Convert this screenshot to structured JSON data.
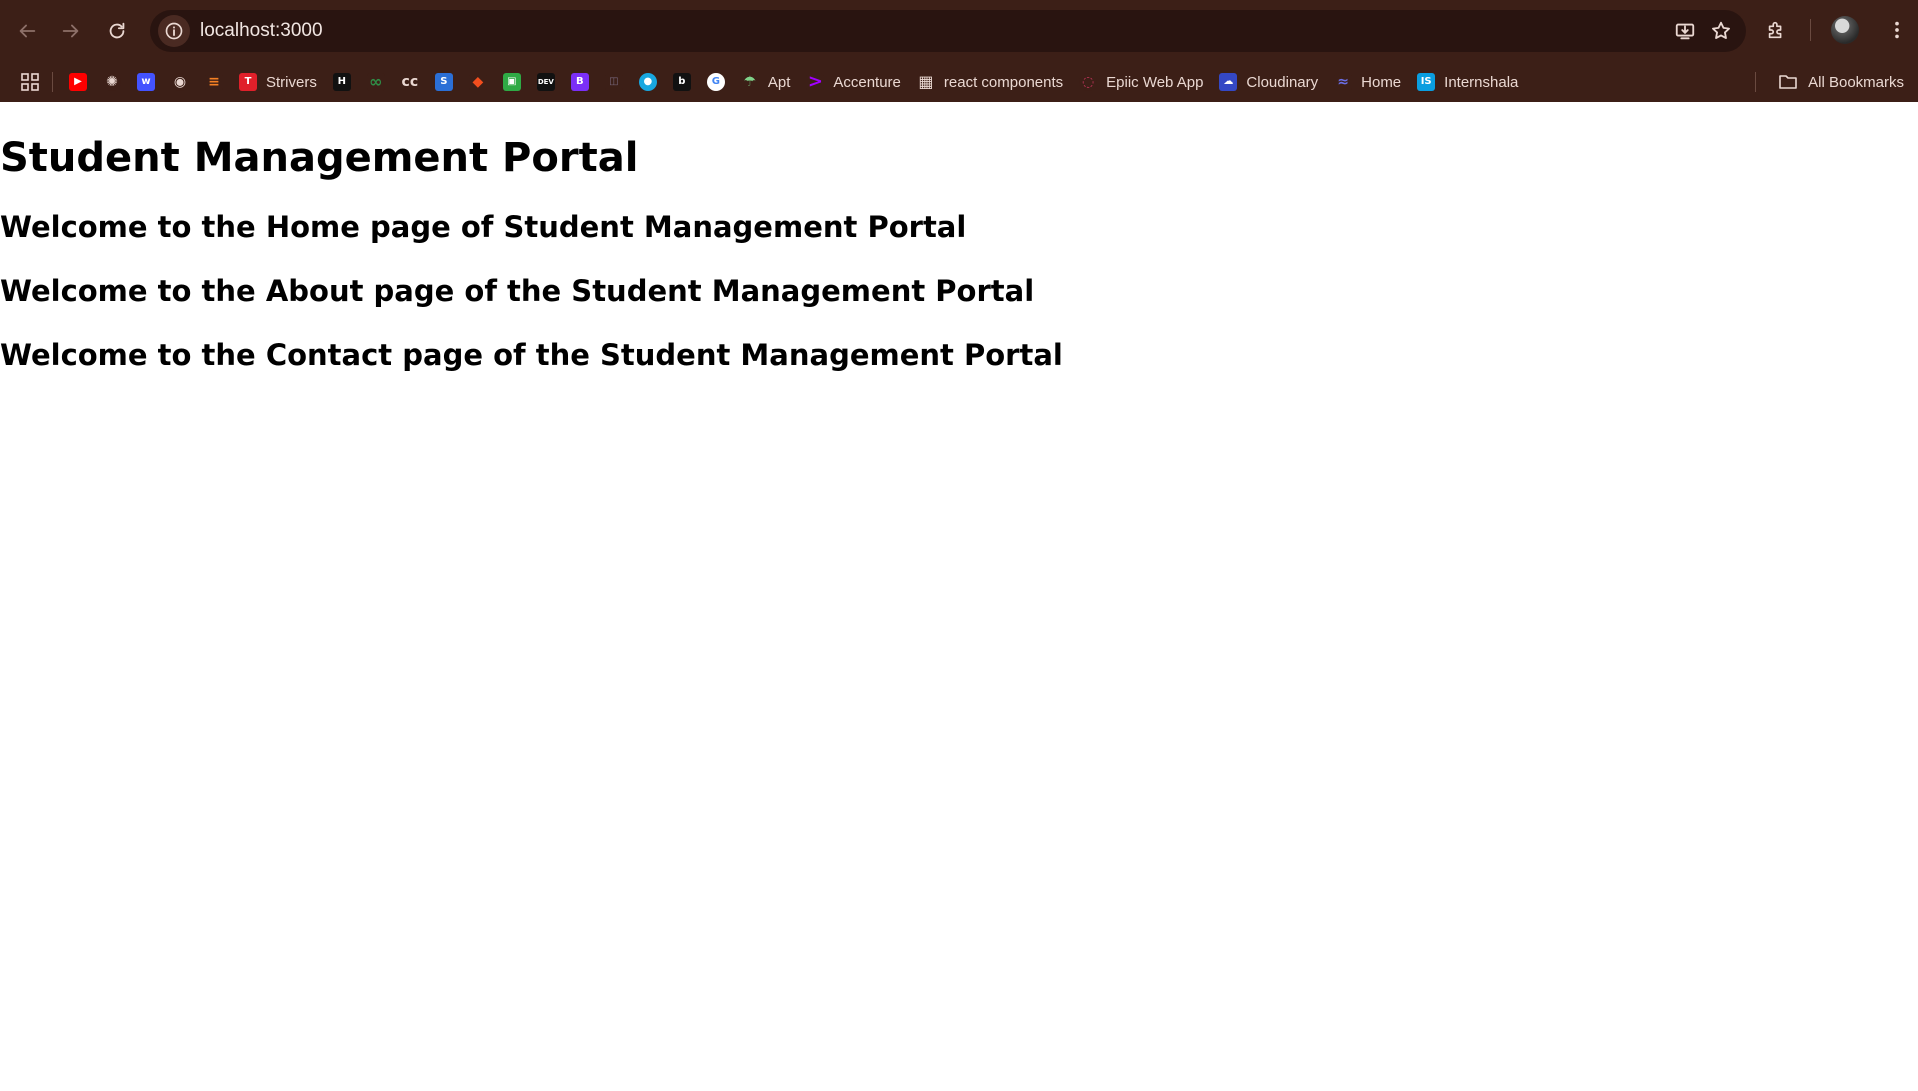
{
  "browser": {
    "url": "localhost:3000",
    "bookmarks": [
      {
        "label": "",
        "icon": "youtube-icon",
        "color": "#ff0000",
        "glyph": "▶"
      },
      {
        "label": "",
        "icon": "chatgpt-icon",
        "color": "#3c1f17",
        "glyph": "✺"
      },
      {
        "label": "",
        "icon": "webflow-icon",
        "color": "#4353ff",
        "glyph": "w"
      },
      {
        "label": "",
        "icon": "github-icon",
        "color": "#3c1f17",
        "glyph": "◉"
      },
      {
        "label": "",
        "icon": "stackoverflow-icon",
        "color": "#3c1f17",
        "glyph": "≡"
      },
      {
        "label": "Strivers",
        "icon": "tuf-icon",
        "color": "#e0202a",
        "glyph": "T"
      },
      {
        "label": "",
        "icon": "hackerrank-icon",
        "color": "#111111",
        "glyph": "H"
      },
      {
        "label": "",
        "icon": "geeksforgeeks-icon",
        "color": "#3c1f17",
        "glyph": "∞"
      },
      {
        "label": "",
        "icon": "codechef-icon",
        "color": "#3c1f17",
        "glyph": "cc"
      },
      {
        "label": "",
        "icon": "leetcode-icon",
        "color": "#2b6fd6",
        "glyph": "S"
      },
      {
        "label": "",
        "icon": "figma-icon",
        "color": "#3c1f17",
        "glyph": "◆"
      },
      {
        "label": "",
        "icon": "greentree-icon",
        "color": "#2faa45",
        "glyph": "▣"
      },
      {
        "label": "",
        "icon": "dev-to-icon",
        "color": "#111111",
        "glyph": "DEV"
      },
      {
        "label": "",
        "icon": "bootstrap-icon",
        "color": "#7b2ff7",
        "glyph": "B"
      },
      {
        "label": "",
        "icon": "gemini-icon",
        "color": "#3c1f17",
        "glyph": "◫"
      },
      {
        "label": "",
        "icon": "messenger-icon",
        "color": "#18a7e0",
        "glyph": "●"
      },
      {
        "label": "",
        "icon": "bing-icon",
        "color": "#111111",
        "glyph": "b"
      },
      {
        "label": "",
        "icon": "google-icon",
        "color": "#ffffff",
        "glyph": "G"
      },
      {
        "label": "Apt",
        "icon": "apt-icon",
        "color": "#3c1f17",
        "glyph": "☂"
      },
      {
        "label": "Accenture",
        "icon": "accenture-icon",
        "color": "#3c1f17",
        "glyph": ">"
      },
      {
        "label": "react components",
        "icon": "react-components-icon",
        "color": "#3c1f17",
        "glyph": "▦"
      },
      {
        "label": "Epiic Web App",
        "icon": "epiic-icon",
        "color": "#3c1f17",
        "glyph": "◌"
      },
      {
        "label": "Cloudinary",
        "icon": "cloudinary-icon",
        "color": "#3448c5",
        "glyph": "☁"
      },
      {
        "label": "Home",
        "icon": "home-bookmark-icon",
        "color": "#3c1f17",
        "glyph": "≈"
      },
      {
        "label": "Internshala",
        "icon": "internshala-icon",
        "color": "#0a9ee0",
        "glyph": "IS"
      }
    ],
    "all_bookmarks_label": "All Bookmarks"
  },
  "page": {
    "title": "Student Management Portal",
    "sections": [
      "Welcome to the Home page of Student Management Portal",
      "Welcome to the About page of the Student Management Portal",
      "Welcome to the Contact page of the Student Management Portal"
    ]
  }
}
